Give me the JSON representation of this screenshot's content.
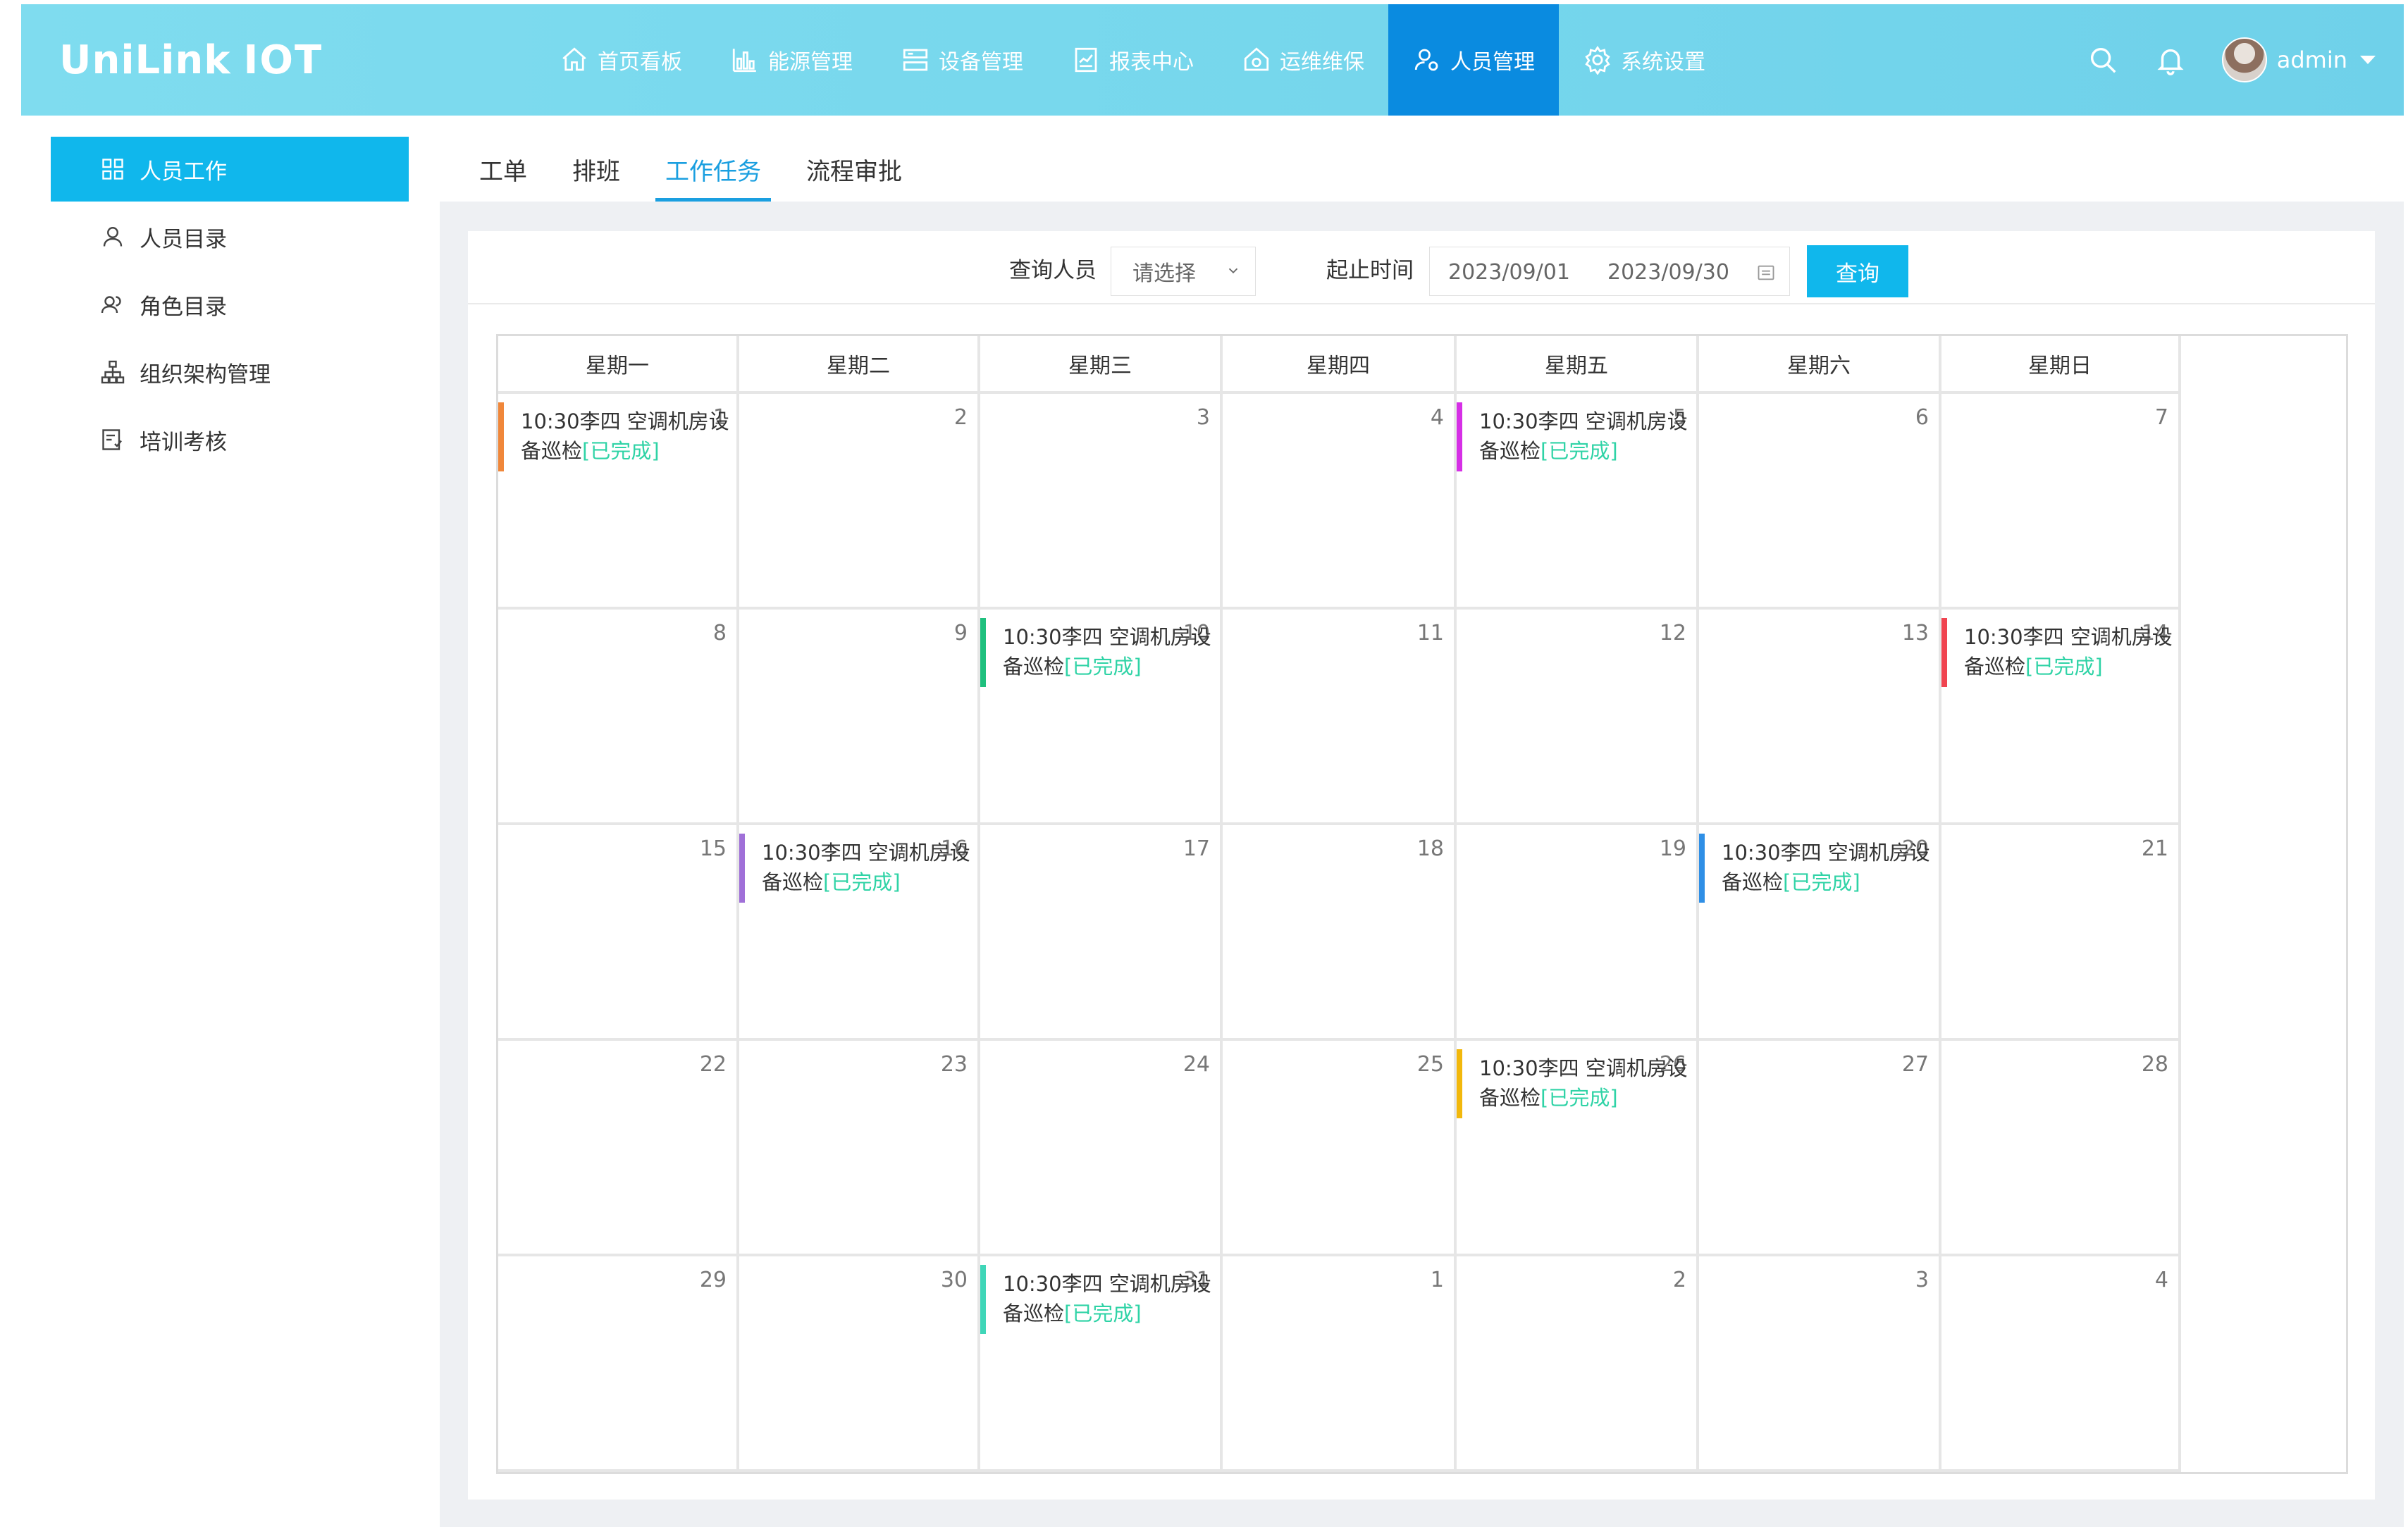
{
  "header": {
    "logo_text": "UniLink",
    "logo_suffix": "IOT",
    "nav": [
      {
        "label": "首页看板",
        "icon": "home-icon",
        "name": "nav-dashboard"
      },
      {
        "label": "能源管理",
        "icon": "bar-chart-icon",
        "name": "nav-energy"
      },
      {
        "label": "设备管理",
        "icon": "server-icon",
        "name": "nav-device"
      },
      {
        "label": "报表中心",
        "icon": "report-icon",
        "name": "nav-report"
      },
      {
        "label": "运维维保",
        "icon": "maintenance-icon",
        "name": "nav-maintenance"
      },
      {
        "label": "人员管理",
        "icon": "user-gear-icon",
        "name": "nav-personnel",
        "active": true
      },
      {
        "label": "系统设置",
        "icon": "gear-icon",
        "name": "nav-settings"
      }
    ],
    "user": "admin"
  },
  "sidebar": {
    "items": [
      {
        "label": "人员工作",
        "icon": "grid-icon",
        "active": true
      },
      {
        "label": "人员目录",
        "icon": "user-icon"
      },
      {
        "label": "角色目录",
        "icon": "users-icon"
      },
      {
        "label": "组织架构管理",
        "icon": "org-chart-icon"
      },
      {
        "label": "培训考核",
        "icon": "exam-icon"
      }
    ]
  },
  "tabs": [
    {
      "label": "工单"
    },
    {
      "label": "排班"
    },
    {
      "label": "工作任务",
      "active": true
    },
    {
      "label": "流程审批"
    }
  ],
  "filter": {
    "person_label": "查询人员",
    "person_placeholder": "请选择",
    "range_label": "起止时间",
    "start_date": "2023/09/01",
    "end_date": "2023/09/30",
    "query_button": "查询"
  },
  "calendar": {
    "weekdays": [
      "星期一",
      "星期二",
      "星期三",
      "星期四",
      "星期五",
      "星期六",
      "星期日"
    ],
    "weeks": [
      [
        "1",
        "2",
        "3",
        "4",
        "5",
        "6",
        "7"
      ],
      [
        "8",
        "9",
        "10",
        "11",
        "12",
        "13",
        "14"
      ],
      [
        "15",
        "16",
        "17",
        "18",
        "19",
        "20",
        "21"
      ],
      [
        "22",
        "23",
        "24",
        "25",
        "26",
        "27",
        "28"
      ],
      [
        "29",
        "30",
        "31",
        "1",
        "2",
        "3",
        "4"
      ]
    ],
    "events": [
      {
        "week": 0,
        "day": 0,
        "text": "10:30李四 空调机房设备巡检",
        "status": "[已完成]",
        "color": "#f0873a"
      },
      {
        "week": 0,
        "day": 4,
        "text": "10:30李四 空调机房设备巡检",
        "status": "[已完成]",
        "color": "#d62fe6"
      },
      {
        "week": 1,
        "day": 2,
        "text": "10:30李四 空调机房设备巡检",
        "status": "[已完成]",
        "color": "#1fc07e"
      },
      {
        "week": 1,
        "day": 6,
        "text": "10:30李四 空调机房设备巡检",
        "status": "[已完成]",
        "color": "#f04450"
      },
      {
        "week": 2,
        "day": 1,
        "text": "10:30李四 空调机房设备巡检",
        "status": "[已完成]",
        "color": "#a070d8"
      },
      {
        "week": 2,
        "day": 5,
        "text": "10:30李四 空调机房设备巡检",
        "status": "[已完成]",
        "color": "#2f8fe6"
      },
      {
        "week": 3,
        "day": 4,
        "text": "10:30李四 空调机房设备巡检",
        "status": "[已完成]",
        "color": "#f2b80c"
      },
      {
        "week": 4,
        "day": 2,
        "text": "10:30李四 空调机房设备巡检",
        "status": "[已完成]",
        "color": "#3fd6b8"
      }
    ]
  },
  "colors": {
    "accent": "#10b7ec",
    "nav_active": "#0a8be0",
    "status_done": "#2fd3a6"
  }
}
